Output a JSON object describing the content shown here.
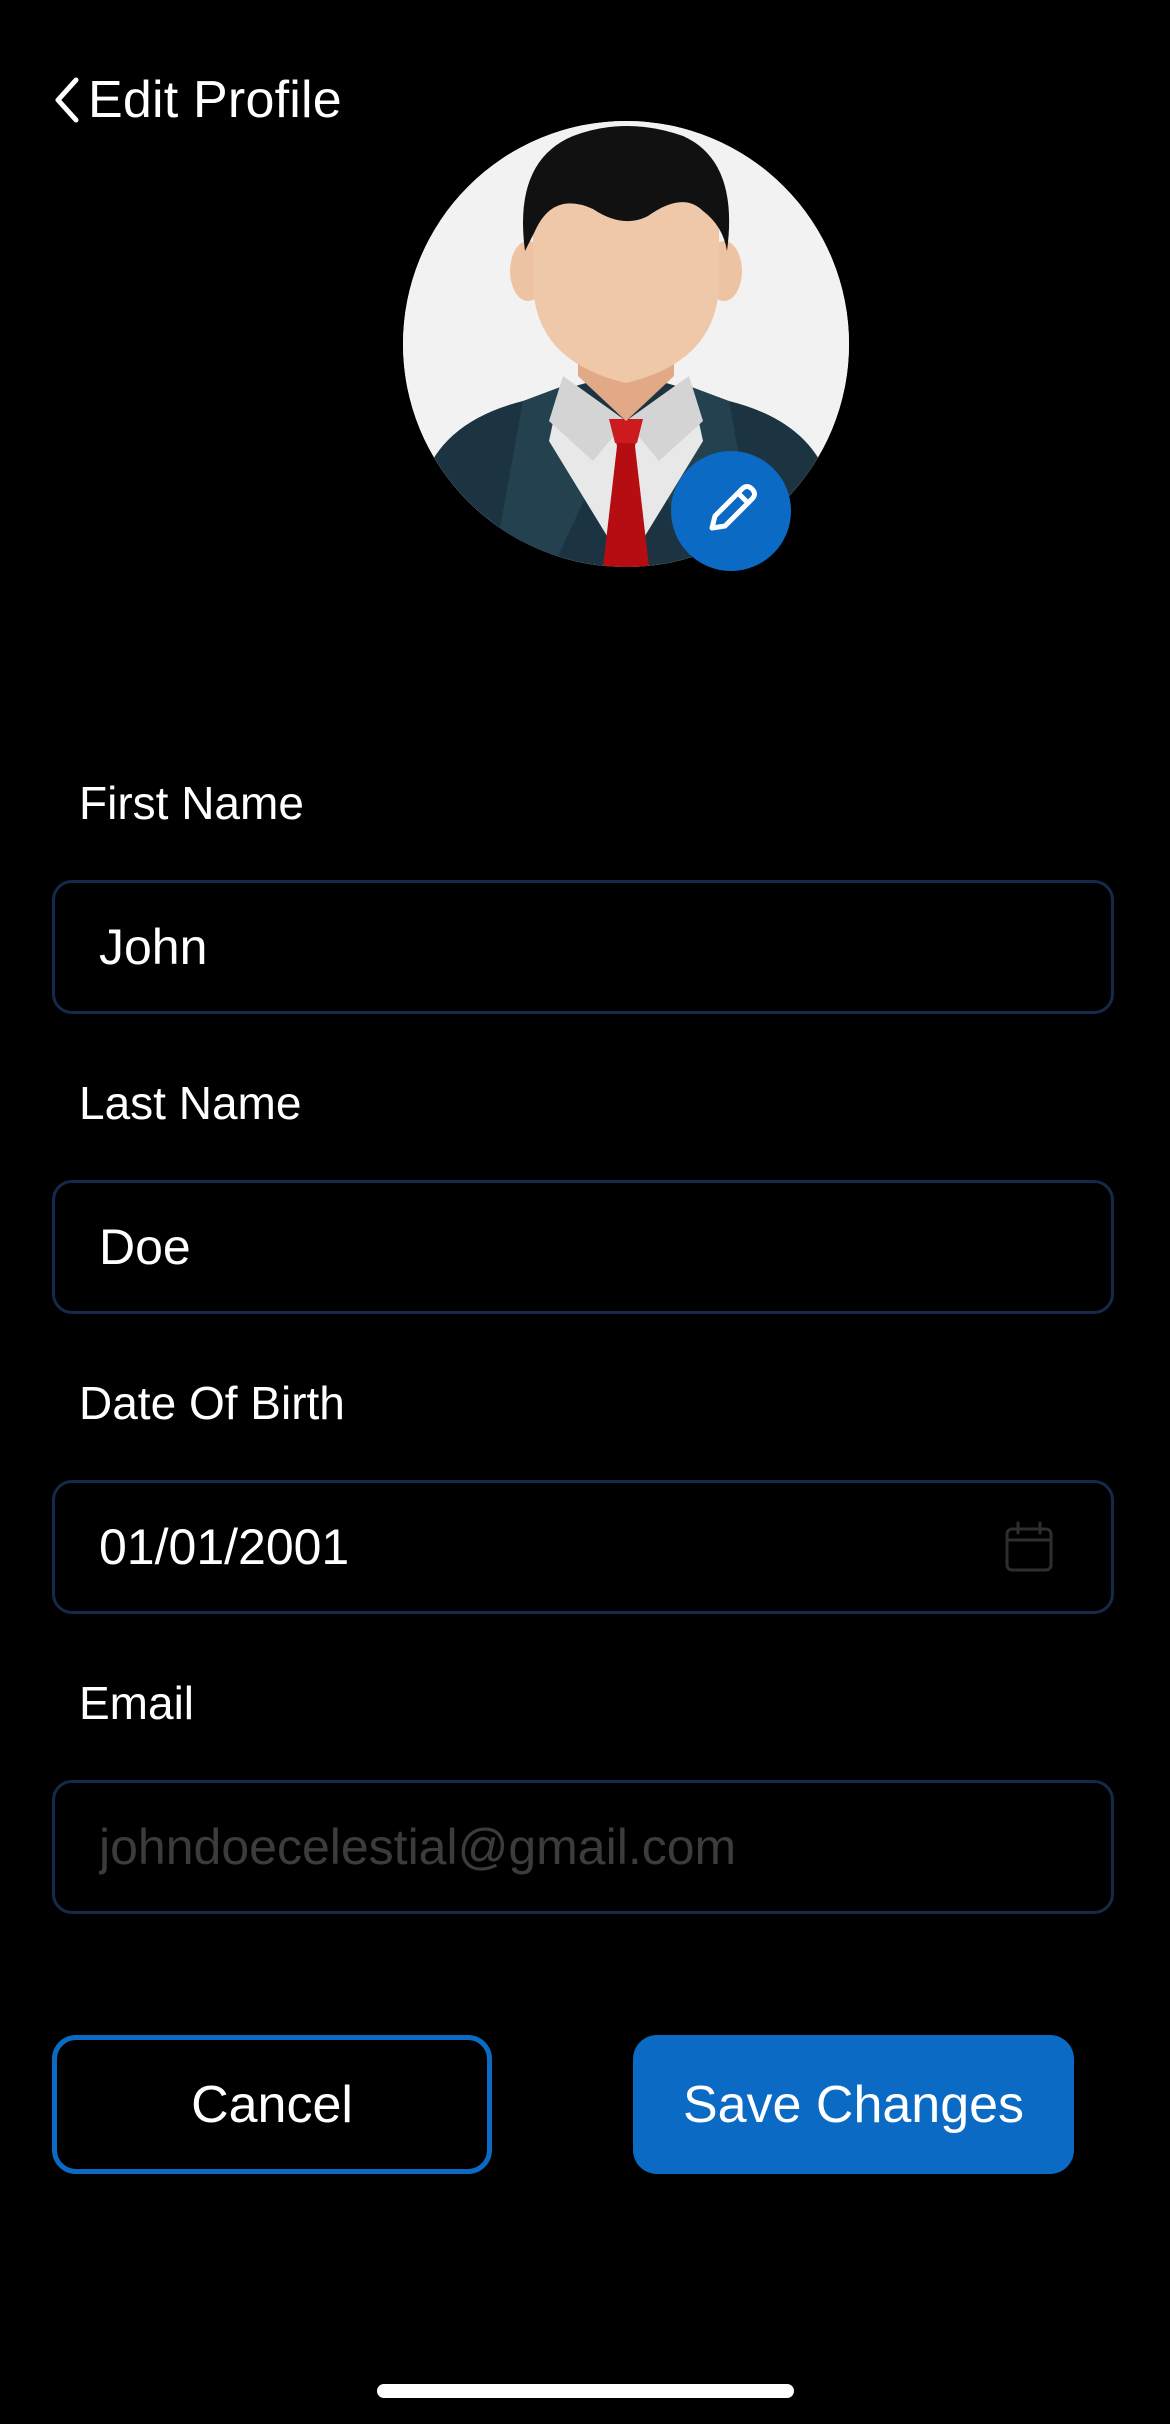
{
  "header": {
    "back_icon": "chevron-left-icon",
    "title": "Edit Profile"
  },
  "avatar": {
    "description_icon": "businessman-avatar",
    "edit_icon": "pencil-icon"
  },
  "form": {
    "first_name": {
      "label": "First Name",
      "value": "John"
    },
    "last_name": {
      "label": "Last Name",
      "value": "Doe"
    },
    "date_of_birth": {
      "label": "Date Of Birth",
      "value": "01/01/2001",
      "icon": "calendar-icon"
    },
    "email": {
      "label": "Email",
      "value": "johndoecelestial@gmail.com",
      "disabled": true
    }
  },
  "actions": {
    "cancel_label": "Cancel",
    "save_label": "Save Changes"
  },
  "colors": {
    "background": "#000000",
    "accent": "#0A6AC4",
    "field_border": "#16294A",
    "disabled_text": "#3C3C3C",
    "text": "#FFFFFF"
  }
}
